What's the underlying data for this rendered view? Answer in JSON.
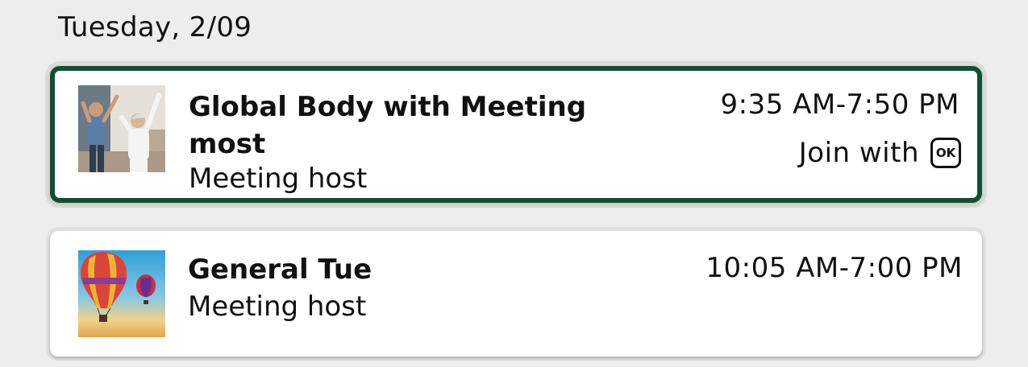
{
  "date_heading": "Tuesday, 2/09",
  "meetings": [
    {
      "title": "Global Body with Meeting most",
      "host": "Meeting host",
      "time": "9:35 AM-7:50 PM",
      "join_label": "Join with",
      "join_icon": "OK",
      "thumbnail": "exercise-couple-image",
      "selected": true
    },
    {
      "title": "General Tue",
      "host": "Meeting host",
      "time": "10:05 AM-7:00 PM",
      "thumbnail": "hot-air-balloons-image",
      "selected": false
    }
  ],
  "colors": {
    "background": "#ededed",
    "card": "#ffffff",
    "selected_border": "#0f5132",
    "text": "#111111"
  }
}
